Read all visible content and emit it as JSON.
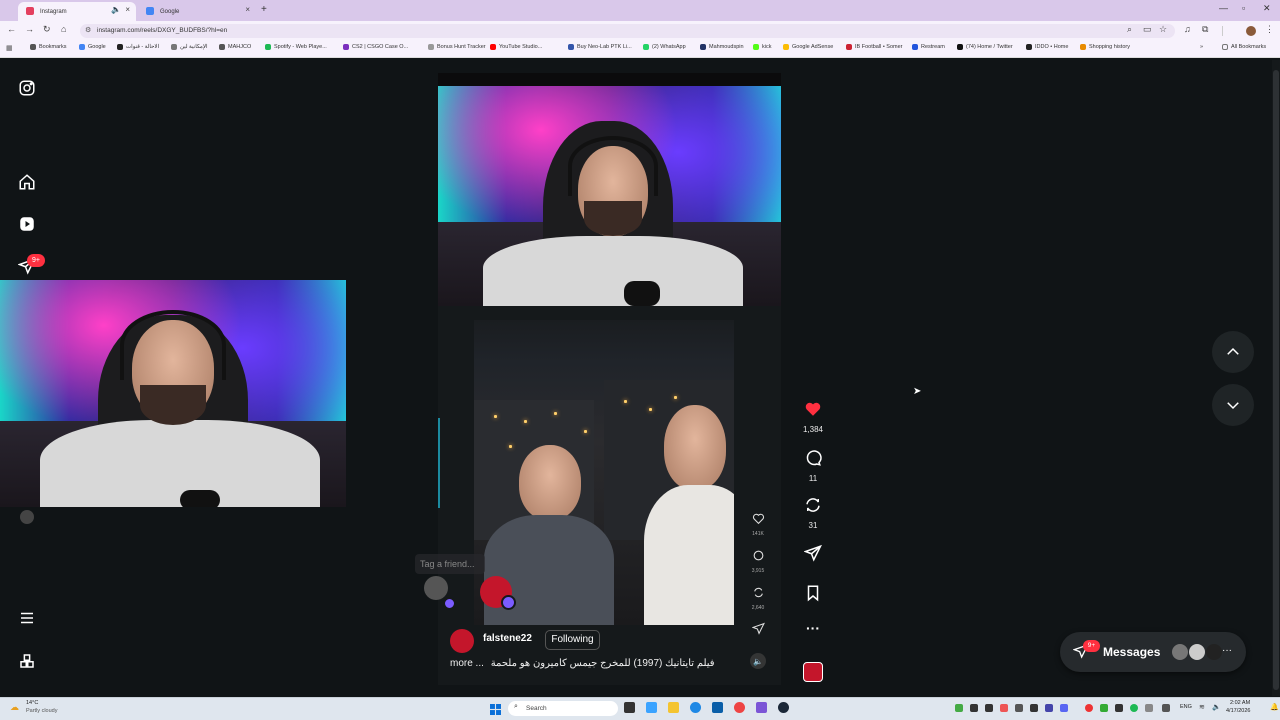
{
  "browser": {
    "tabs": [
      {
        "title": "Instagram",
        "favicon_color": "#e4405f",
        "active": true
      },
      {
        "title": "Google",
        "favicon_color": "#4285f4",
        "active": false
      }
    ],
    "new_tab_label": "+",
    "url": "instagram.com/reels/DXGY_BUDFBS/?hl=en",
    "bookmarks": [
      {
        "label": "Bookmarks",
        "color": "#555"
      },
      {
        "label": "Google",
        "color": "#4285f4"
      },
      {
        "label": "الاحالة - قنوات",
        "color": "#222"
      },
      {
        "label": "الإمكانية لين",
        "color": "#777"
      },
      {
        "label": "MAHJCO",
        "color": "#555"
      },
      {
        "label": "Spotify - Web Playe...",
        "color": "#1db954"
      },
      {
        "label": "CS2 | CSGO Case O...",
        "color": "#7b2fbe"
      },
      {
        "label": "Bonus Hunt Tracker",
        "color": "#999"
      },
      {
        "label": "YouTube Studio...",
        "color": "#ff0000"
      },
      {
        "label": "Buy Neo-Lab PTK Li...",
        "color": "#3355aa"
      },
      {
        "label": "(2) WhatsApp",
        "color": "#25d366"
      },
      {
        "label": "Mahmoudspin",
        "color": "#223366"
      },
      {
        "label": "kick",
        "color": "#53fc18"
      },
      {
        "label": "Google AdSense",
        "color": "#fbbc05"
      },
      {
        "label": "IB Football • Somer",
        "color": "#cc2233"
      },
      {
        "label": "Restream",
        "color": "#2255dd"
      },
      {
        "label": "(74) Home / Twitter",
        "color": "#111"
      },
      {
        "label": "IDDO • Home",
        "color": "#222"
      },
      {
        "label": "Shopping history",
        "color": "#e88b00"
      }
    ],
    "all_bookmarks_label": "All Bookmarks"
  },
  "sidebar": {
    "notif_badge": "9+"
  },
  "reel": {
    "video_actions": [
      {
        "icon": "heart-outline-icon",
        "count": "141K"
      },
      {
        "icon": "comment-icon",
        "count": "3,915"
      },
      {
        "icon": "repost-icon",
        "count": "2,640"
      },
      {
        "icon": "share-icon",
        "count": ""
      }
    ],
    "tag_placeholder": "Tag a friend...",
    "author": "falstene22",
    "follow_label": "Following",
    "caption_more": "more ...",
    "caption": "فيلم تايتانيك (1997) للمخرج جيمس كاميرون هو ملحمة"
  },
  "actions": {
    "like_count": "1,384",
    "comment_count": "11",
    "repost_count": "31",
    "like_color": "#ff3040"
  },
  "messages": {
    "label": "Messages",
    "badge": "9+"
  },
  "taskbar": {
    "weather_temp": "14°C",
    "weather_desc": "Partly cloudy",
    "search_placeholder": "Search",
    "lang": "ENG",
    "time": "2:02 AM",
    "date": "4/17/2026"
  }
}
